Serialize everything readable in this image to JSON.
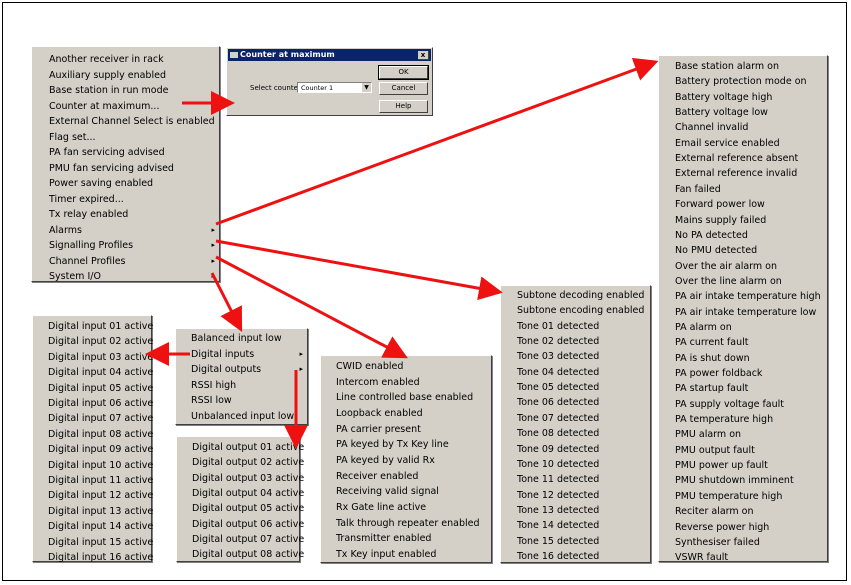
{
  "main_menu": {
    "items": [
      {
        "label": "Another receiver in rack"
      },
      {
        "label": "Auxiliary supply enabled"
      },
      {
        "label": "Base station in run mode"
      },
      {
        "label": "Counter at maximum..."
      },
      {
        "label": "External Channel Select is enabled"
      },
      {
        "label": "Flag set..."
      },
      {
        "label": "PA fan servicing advised"
      },
      {
        "label": "PMU fan servicing advised"
      },
      {
        "label": "Power saving enabled"
      },
      {
        "label": "Timer expired..."
      },
      {
        "label": "Tx relay enabled"
      },
      {
        "label": "Alarms",
        "submenu": "▸"
      },
      {
        "label": "Signalling Profiles",
        "submenu": "▸"
      },
      {
        "label": "Channel Profiles",
        "submenu": "▸"
      },
      {
        "label": "System I/O",
        "submenu": "▸"
      }
    ]
  },
  "dialog": {
    "title": "Counter at maximum",
    "close": "x",
    "select_label": "Select counter",
    "select_value": "Counter 1",
    "ok": "OK",
    "cancel": "Cancel",
    "help": "Help"
  },
  "alarms_menu": {
    "items": [
      {
        "label": "Base station alarm on"
      },
      {
        "label": "Battery protection mode on"
      },
      {
        "label": "Battery voltage high"
      },
      {
        "label": "Battery voltage low"
      },
      {
        "label": "Channel invalid"
      },
      {
        "label": "Email service enabled"
      },
      {
        "label": "External reference absent"
      },
      {
        "label": "External reference invalid"
      },
      {
        "label": "Fan failed"
      },
      {
        "label": "Forward power low"
      },
      {
        "label": "Mains supply failed"
      },
      {
        "label": "No PA detected"
      },
      {
        "label": "No PMU detected"
      },
      {
        "label": "Over the air alarm on"
      },
      {
        "label": "Over the line alarm on"
      },
      {
        "label": "PA air intake temperature high"
      },
      {
        "label": "PA air intake temperature low"
      },
      {
        "label": "PA alarm on"
      },
      {
        "label": "PA current fault"
      },
      {
        "label": "PA is shut down"
      },
      {
        "label": "PA power foldback"
      },
      {
        "label": "PA startup fault"
      },
      {
        "label": "PA supply voltage fault"
      },
      {
        "label": "PA temperature high"
      },
      {
        "label": "PMU alarm on"
      },
      {
        "label": "PMU output fault"
      },
      {
        "label": "PMU power up fault"
      },
      {
        "label": "PMU shutdown imminent"
      },
      {
        "label": "PMU temperature high"
      },
      {
        "label": "Reciter alarm on"
      },
      {
        "label": "Reverse power high"
      },
      {
        "label": "Synthesiser failed"
      },
      {
        "label": "VSWR fault"
      }
    ]
  },
  "signalling_menu": {
    "items": [
      {
        "label": "Subtone decoding enabled"
      },
      {
        "label": "Subtone encoding enabled"
      },
      {
        "label": "Tone 01 detected"
      },
      {
        "label": "Tone 02 detected"
      },
      {
        "label": "Tone 03 detected"
      },
      {
        "label": "Tone 04 detected"
      },
      {
        "label": "Tone 05 detected"
      },
      {
        "label": "Tone 06 detected"
      },
      {
        "label": "Tone 07 detected"
      },
      {
        "label": "Tone 08 detected"
      },
      {
        "label": "Tone 09 detected"
      },
      {
        "label": "Tone 10 detected"
      },
      {
        "label": "Tone 11 detected"
      },
      {
        "label": "Tone 12 detected"
      },
      {
        "label": "Tone 13 detected"
      },
      {
        "label": "Tone 14 detected"
      },
      {
        "label": "Tone 15 detected"
      },
      {
        "label": "Tone 16 detected"
      }
    ]
  },
  "channel_menu": {
    "items": [
      {
        "label": "CWID enabled"
      },
      {
        "label": "Intercom enabled"
      },
      {
        "label": "Line controlled base enabled"
      },
      {
        "label": "Loopback enabled"
      },
      {
        "label": "PA carrier present"
      },
      {
        "label": "PA keyed by Tx Key line"
      },
      {
        "label": "PA keyed by valid Rx"
      },
      {
        "label": "Receiver enabled"
      },
      {
        "label": "Receiving valid signal"
      },
      {
        "label": "Rx Gate line active"
      },
      {
        "label": "Talk through repeater enabled"
      },
      {
        "label": "Transmitter enabled"
      },
      {
        "label": "Tx Key input enabled"
      }
    ]
  },
  "system_io_menu": {
    "items": [
      {
        "label": "Balanced input low"
      },
      {
        "label": "Digital inputs",
        "submenu": "▸"
      },
      {
        "label": "Digital outputs",
        "submenu": "▸"
      },
      {
        "label": "RSSI high"
      },
      {
        "label": "RSSI low"
      },
      {
        "label": "Unbalanced input low"
      }
    ]
  },
  "digital_inputs_menu": {
    "items": [
      {
        "label": "Digital input 01 active"
      },
      {
        "label": "Digital input 02 active"
      },
      {
        "label": "Digital input 03 active"
      },
      {
        "label": "Digital input 04 active"
      },
      {
        "label": "Digital input 05 active"
      },
      {
        "label": "Digital input 06 active"
      },
      {
        "label": "Digital input 07 active"
      },
      {
        "label": "Digital input 08 active"
      },
      {
        "label": "Digital input 09 active"
      },
      {
        "label": "Digital input 10 active"
      },
      {
        "label": "Digital input 11 active"
      },
      {
        "label": "Digital input 12 active"
      },
      {
        "label": "Digital input 13 active"
      },
      {
        "label": "Digital input 14 active"
      },
      {
        "label": "Digital input 15 active"
      },
      {
        "label": "Digital input 16 active"
      }
    ]
  },
  "digital_outputs_menu": {
    "items": [
      {
        "label": "Digital output 01 active"
      },
      {
        "label": "Digital output 02 active"
      },
      {
        "label": "Digital output 03 active"
      },
      {
        "label": "Digital output 04 active"
      },
      {
        "label": "Digital output 05 active"
      },
      {
        "label": "Digital output 06 active"
      },
      {
        "label": "Digital output 07 active"
      },
      {
        "label": "Digital output 08 active"
      }
    ]
  },
  "colors": {
    "arrow": "#ee1111",
    "menu_bg": "#d4d0c8",
    "titlebar": "#0a246a"
  }
}
